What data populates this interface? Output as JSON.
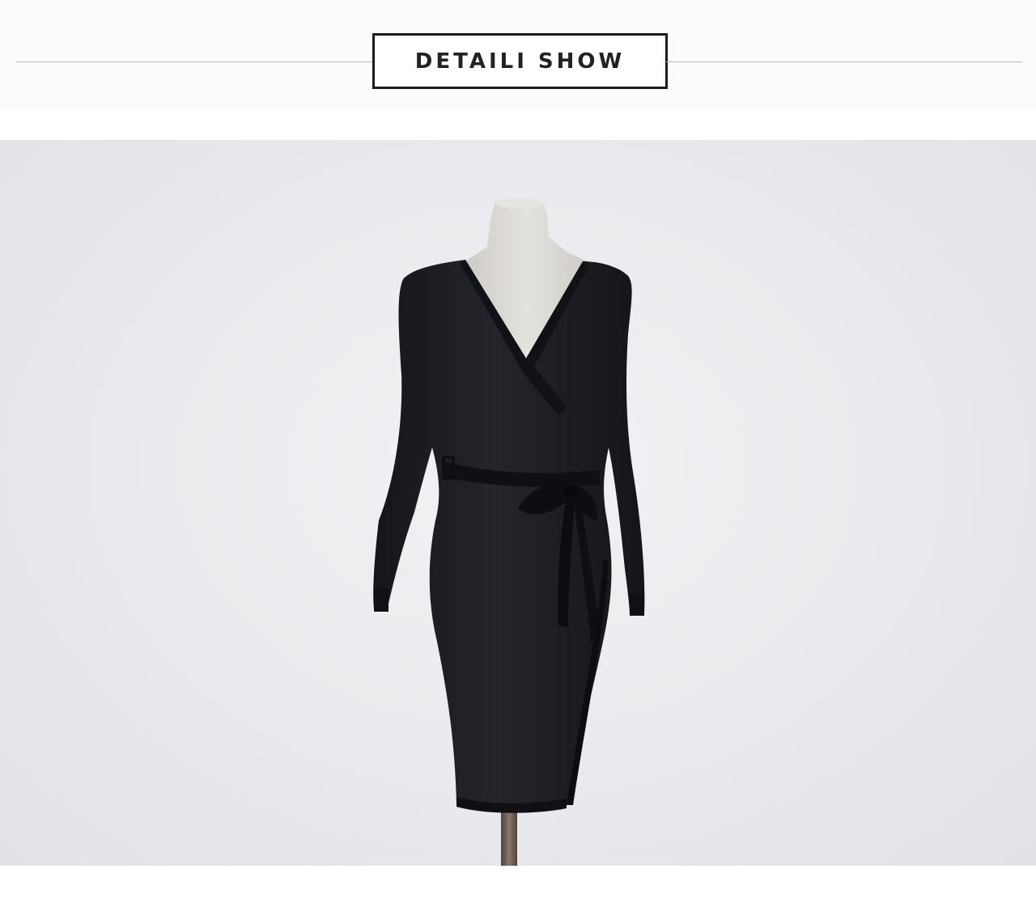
{
  "header": {
    "title": "DETAILI SHOW"
  },
  "photo": {
    "subject": "black-wrap-dress-on-mannequin",
    "colors": {
      "background": "#e9eaed",
      "dress": "#1c1d21",
      "mannequin": "#d9d7d2",
      "stand": "#6b5c52"
    }
  }
}
